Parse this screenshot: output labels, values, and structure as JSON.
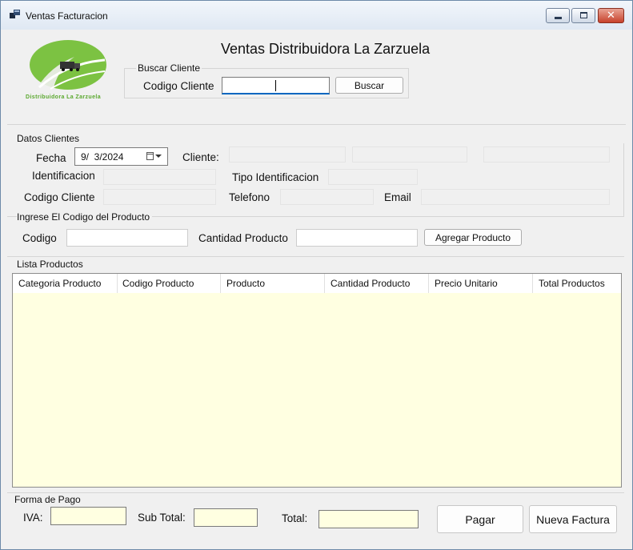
{
  "window": {
    "title": "Ventas Facturacion"
  },
  "header": {
    "title": "Ventas Distribuidora La Zarzuela",
    "logo_text": "Distribuidora La Zarzuela"
  },
  "buscar_cliente": {
    "group_label": "Buscar Cliente",
    "codigo_label": "Codigo Cliente",
    "codigo_value": "",
    "button_label": "Buscar"
  },
  "datos_clientes": {
    "group_label": "Datos Clientes",
    "fecha_label": "Fecha",
    "fecha_value": "9/  3/2024",
    "cliente_label": "Cliente:",
    "identificacion_label": "Identificacion",
    "tipo_identificacion_label": "Tipo Identificacion",
    "codigo_cliente_label": "Codigo Cliente",
    "telefono_label": "Telefono",
    "email_label": "Email"
  },
  "producto": {
    "group_label": "Ingrese El Codigo del Producto",
    "codigo_label": "Codigo",
    "codigo_value": "",
    "cantidad_label": "Cantidad Producto",
    "cantidad_value": "",
    "agregar_label": "Agregar Producto"
  },
  "lista_productos": {
    "group_label": "Lista Productos",
    "columns": [
      "Categoria Producto",
      "Codigo Producto",
      "Producto",
      "Cantidad Producto",
      "Precio Unitario",
      "Total Productos"
    ],
    "rows": []
  },
  "forma_pago": {
    "group_label": "Forma de Pago",
    "iva_label": "IVA:",
    "subtotal_label": "Sub Total:",
    "total_label": "Total:",
    "pagar_label": "Pagar",
    "nueva_factura_label": "Nueva Factura"
  },
  "colors": {
    "grid_background": "#ffffe1",
    "logo_green": "#7cc242",
    "focus_underline": "#0067c0"
  }
}
